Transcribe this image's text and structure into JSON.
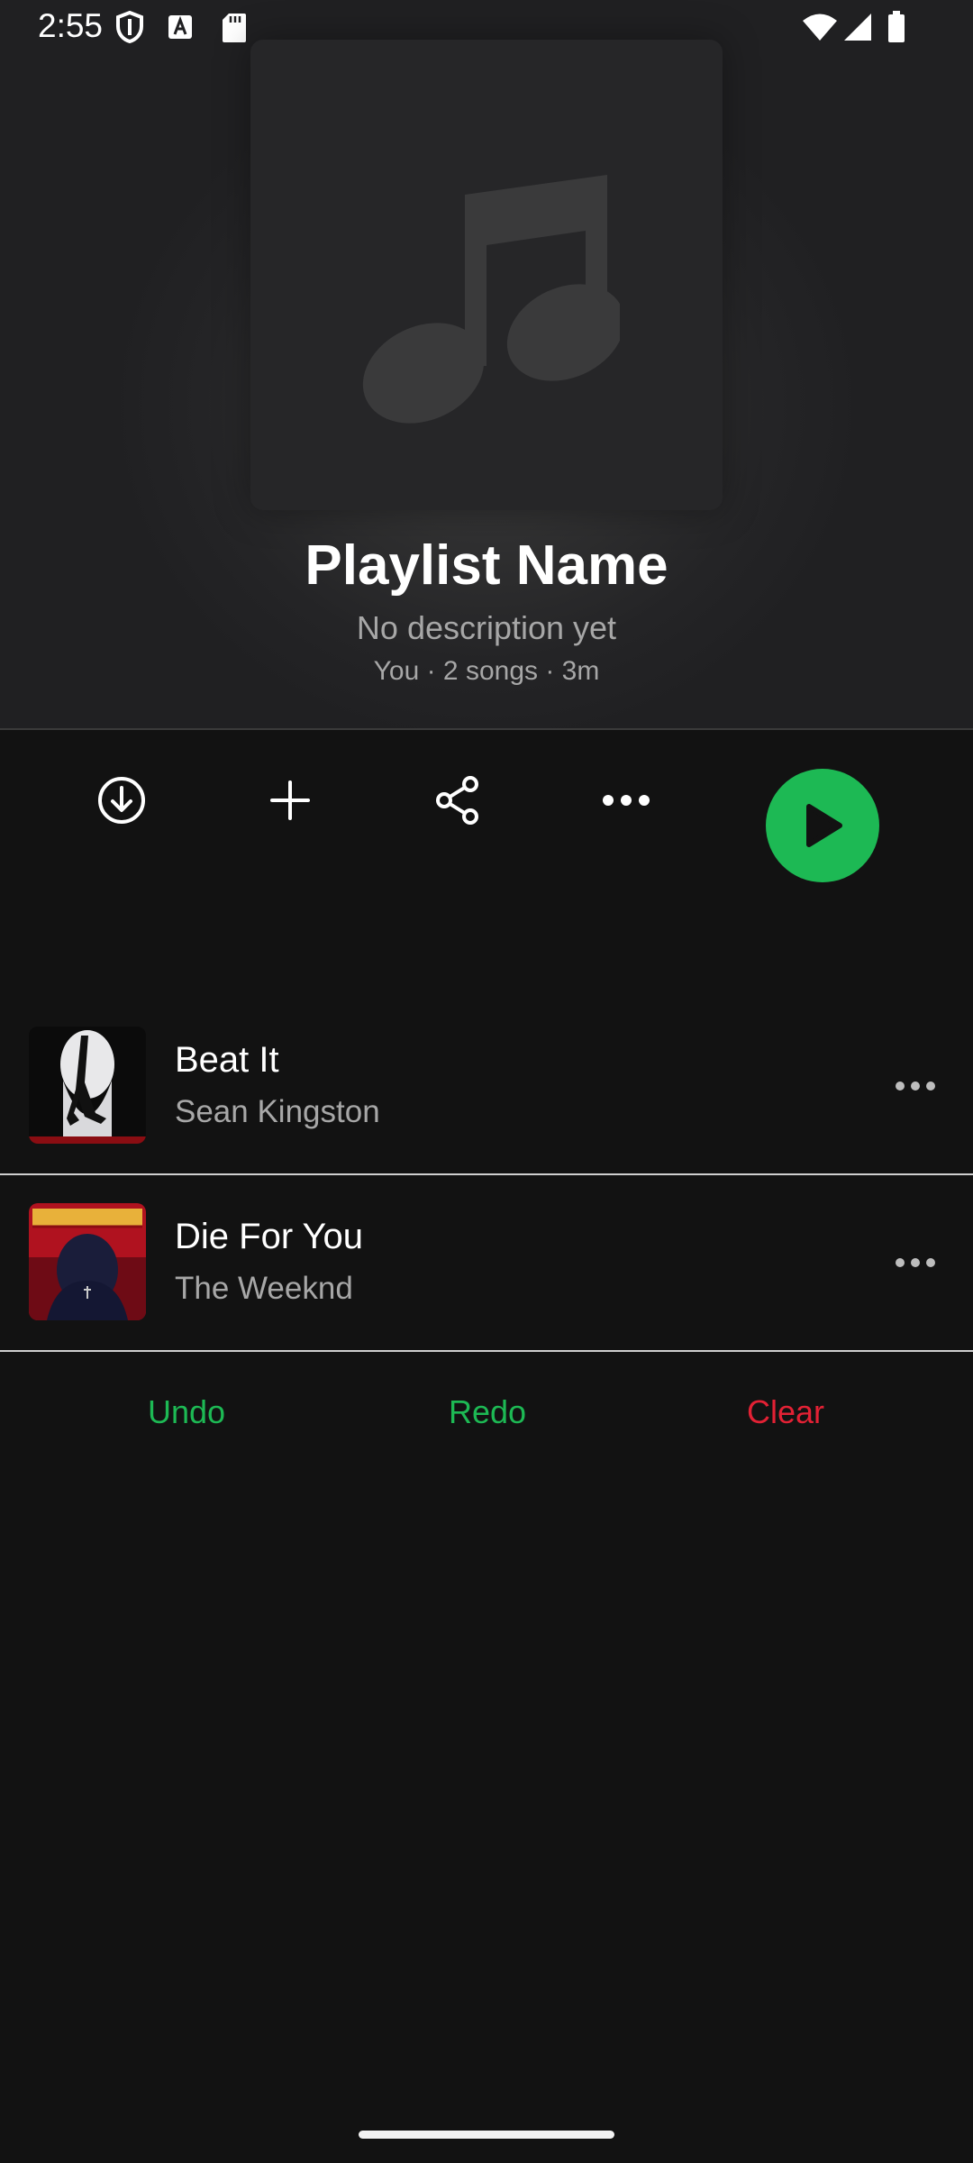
{
  "status_bar": {
    "time": "2:55",
    "left_icons": [
      "shield-icon",
      "font-a-icon",
      "sd-card-icon"
    ],
    "right_icons": [
      "wifi-icon",
      "signal-icon",
      "battery-icon"
    ]
  },
  "playlist": {
    "cover_icon": "music-note-icon",
    "name": "Playlist Name",
    "description": "No description yet",
    "meta": "You · 2 songs · 3m"
  },
  "actions": {
    "icons": [
      "download-icon",
      "plus-icon",
      "share-icon",
      "more-icon"
    ],
    "play_icon": "play-icon",
    "accent": "#1db954"
  },
  "tracks": [
    {
      "title": "Beat It",
      "artist": "Sean Kingston"
    },
    {
      "title": "Die For You",
      "artist": "The Weeknd"
    }
  ],
  "controls": {
    "undo": "Undo",
    "redo": "Redo",
    "clear": "Clear",
    "undo_color": "#1db954",
    "clear_color": "#e22134"
  }
}
